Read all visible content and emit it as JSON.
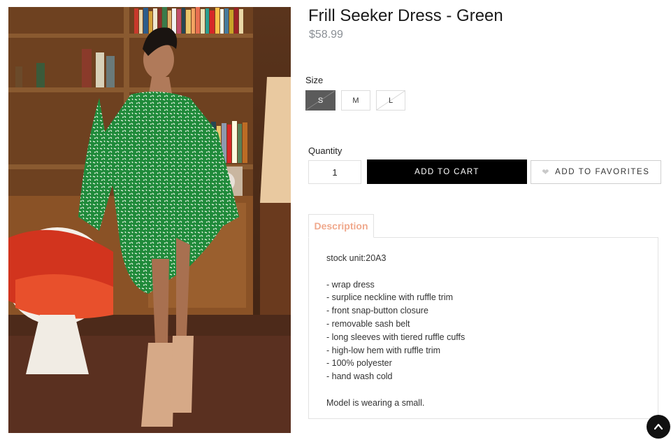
{
  "product": {
    "title": "Frill Seeker Dress - Green",
    "price": "$58.99",
    "image_alt_subject": "model wearing green print ruffle wrap dress"
  },
  "size": {
    "label": "Size",
    "options": [
      {
        "label": "S",
        "selected": true,
        "available": false
      },
      {
        "label": "M",
        "selected": false,
        "available": true
      },
      {
        "label": "L",
        "selected": false,
        "available": false
      }
    ]
  },
  "quantity": {
    "label": "Quantity",
    "value": "1"
  },
  "actions": {
    "add_to_cart": "ADD TO CART",
    "add_to_favorites": "ADD TO FAVORITES",
    "favorites_icon": "heart-icon"
  },
  "tabs": [
    {
      "label": "Description",
      "active": true
    }
  ],
  "description": {
    "sku_line": "stock unit:20A3",
    "bullets": [
      "- wrap dress",
      "- surplice neckline with ruffle trim",
      "- front snap-button closure",
      "- removable sash belt",
      "- long sleeves with tiered ruffle cuffs",
      "- high-low hem with ruffle trim",
      "- 100% polyester",
      "- hand wash cold"
    ],
    "model_note": "Model is wearing a small."
  },
  "colors": {
    "accent_tab": "#f0a98d",
    "price": "#8a8f95",
    "selected_size": "#5b5b5b",
    "cart_button": "#000000"
  },
  "scroll_top_icon": "chevron-up-icon"
}
